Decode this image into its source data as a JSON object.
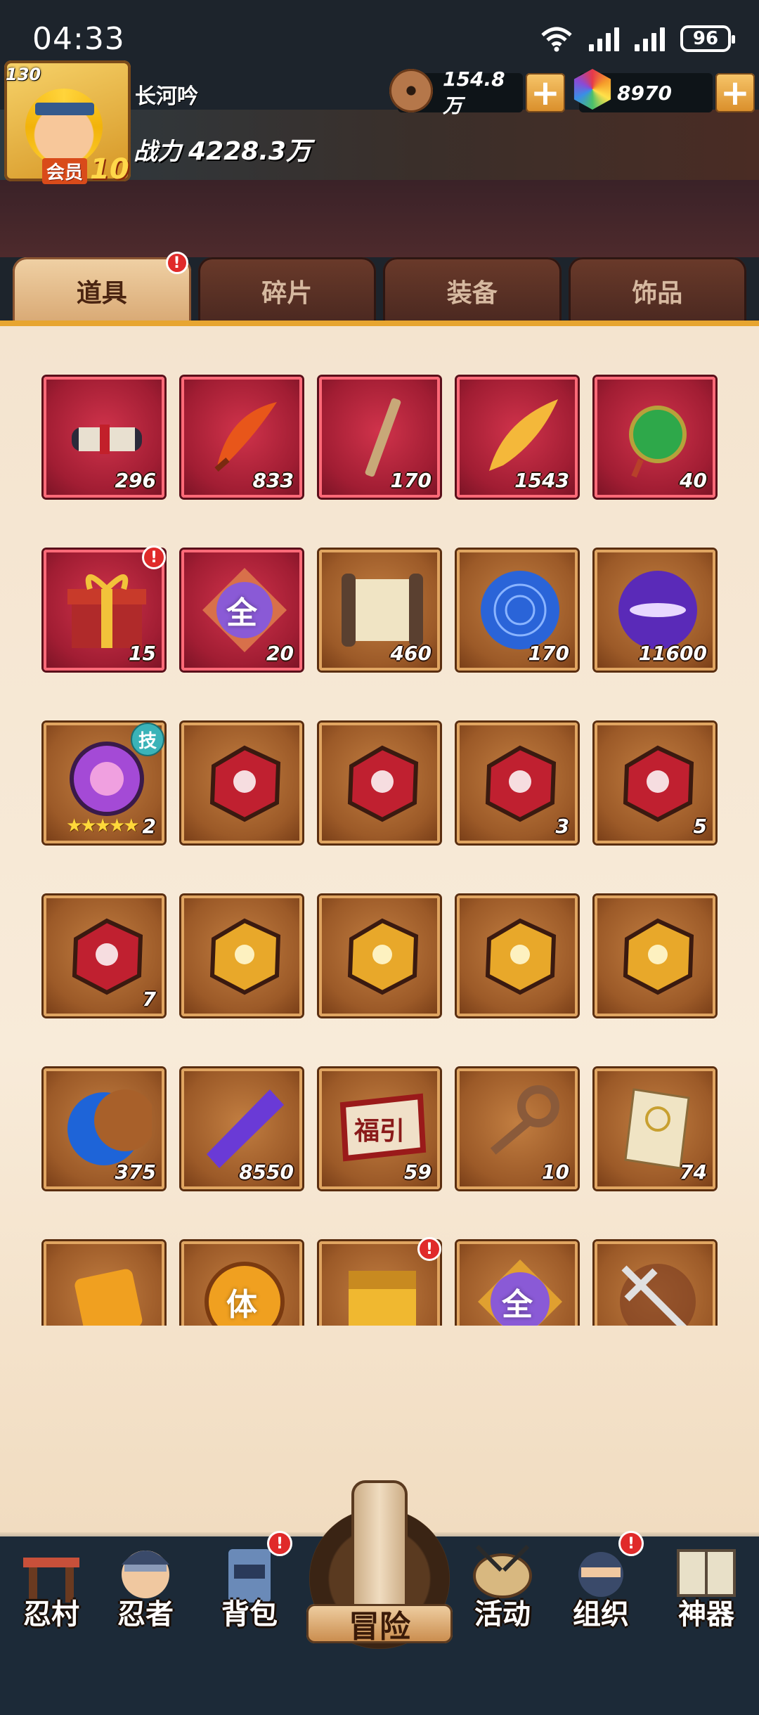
{
  "status_bar": {
    "time": "04:33",
    "battery": "96"
  },
  "player": {
    "level": "130",
    "vip_label": "会员",
    "vip_level": "10",
    "name": "长河吟",
    "power_label": "战力",
    "power_value": "4228.3万"
  },
  "resources": {
    "coins": "154.8万",
    "gems": "8970"
  },
  "tabs": [
    {
      "label": "道具",
      "active": true,
      "badge": "!"
    },
    {
      "label": "碎片"
    },
    {
      "label": "装备"
    },
    {
      "label": "饰品"
    }
  ],
  "items": [
    {
      "icon": "scroll-bundle-icon",
      "count": "296",
      "frame": "red"
    },
    {
      "icon": "red-feather-icon",
      "count": "833",
      "frame": "red"
    },
    {
      "icon": "wooden-stick-icon",
      "count": "170",
      "frame": "red"
    },
    {
      "icon": "golden-feather-icon",
      "count": "1543",
      "frame": "red"
    },
    {
      "icon": "green-jade-pendant-icon",
      "count": "40",
      "frame": "red"
    },
    {
      "icon": "gift-box-icon",
      "count": "15",
      "frame": "red",
      "badge": "!"
    },
    {
      "icon": "all-crystal-icon",
      "count": "20",
      "frame": "red",
      "glyph": "全"
    },
    {
      "icon": "ancient-scroll-icon",
      "count": "460",
      "frame": "brown"
    },
    {
      "icon": "blue-orb-icon",
      "count": "170",
      "frame": "brown"
    },
    {
      "icon": "purple-orb-icon",
      "count": "11600",
      "frame": "brown"
    },
    {
      "icon": "skill-orb-icon",
      "count": "2",
      "frame": "brown",
      "tag": "技",
      "stars": "★★★★★"
    },
    {
      "icon": "red-rune-stone-icon",
      "count": "",
      "frame": "brown"
    },
    {
      "icon": "red-rune-stone-icon",
      "count": "",
      "frame": "brown"
    },
    {
      "icon": "red-rune-stone-icon",
      "count": "3",
      "frame": "brown"
    },
    {
      "icon": "red-rune-stone-icon",
      "count": "5",
      "frame": "brown"
    },
    {
      "icon": "red-rune-stone-icon",
      "count": "7",
      "frame": "brown"
    },
    {
      "icon": "gold-rune-stone-icon",
      "count": "",
      "frame": "brown"
    },
    {
      "icon": "gold-rune-stone-icon",
      "count": "",
      "frame": "brown"
    },
    {
      "icon": "gold-rune-stone-icon",
      "count": "",
      "frame": "brown"
    },
    {
      "icon": "gold-rune-stone-icon",
      "count": "",
      "frame": "brown"
    },
    {
      "icon": "blue-crescent-moon-icon",
      "count": "375",
      "frame": "brown"
    },
    {
      "icon": "purple-crystal-shard-icon",
      "count": "8550",
      "frame": "brown"
    },
    {
      "icon": "fortune-banner-icon",
      "count": "59",
      "frame": "brown",
      "glyph": "福引"
    },
    {
      "icon": "bronze-key-icon",
      "count": "10",
      "frame": "brown"
    },
    {
      "icon": "paper-talisman-icon",
      "count": "74",
      "frame": "brown"
    },
    {
      "icon": "gold-cube-icon",
      "count": "",
      "frame": "brown"
    },
    {
      "icon": "stamina-orb-icon",
      "count": "",
      "frame": "brown",
      "glyph": "体"
    },
    {
      "icon": "golden-chest-icon",
      "count": "",
      "frame": "brown",
      "badge": "!"
    },
    {
      "icon": "all-orb-icon",
      "count": "",
      "frame": "brown",
      "glyph": "全"
    },
    {
      "icon": "shuriken-arrow-icon",
      "count": "",
      "frame": "brown"
    }
  ],
  "nav": [
    {
      "label": "忍村",
      "icon": "village-gate-icon"
    },
    {
      "label": "忍者",
      "icon": "ninja-head-icon"
    },
    {
      "label": "背包",
      "icon": "backpack-icon",
      "badge": "!"
    },
    {
      "label": "冒险",
      "icon": "adventure-scroll-icon",
      "center": true
    },
    {
      "label": "活动",
      "icon": "event-drum-icon"
    },
    {
      "label": "组织",
      "icon": "organization-ninja-icon",
      "badge": "!"
    },
    {
      "label": "神器",
      "icon": "artifact-book-icon"
    }
  ],
  "colors": {
    "accent": "#e7a530",
    "red_frame": "#a11d33",
    "brown_frame": "#9c5a28",
    "badge": "#e02a2a"
  }
}
